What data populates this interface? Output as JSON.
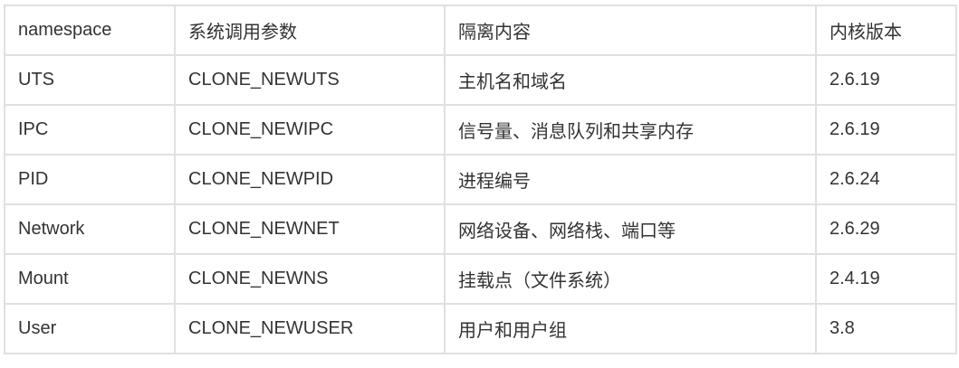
{
  "table": {
    "headers": [
      "namespace",
      "系统调用参数",
      "隔离内容",
      "内核版本"
    ],
    "rows": [
      [
        "UTS",
        "CLONE_NEWUTS",
        "主机名和域名",
        "2.6.19"
      ],
      [
        "IPC",
        "CLONE_NEWIPC",
        "信号量、消息队列和共享内存",
        "2.6.19"
      ],
      [
        "PID",
        "CLONE_NEWPID",
        "进程编号",
        "2.6.24"
      ],
      [
        "Network",
        "CLONE_NEWNET",
        "网络设备、网络栈、端口等",
        "2.6.29"
      ],
      [
        "Mount",
        "CLONE_NEWNS",
        "挂载点（文件系统）",
        "2.4.19"
      ],
      [
        "User",
        "CLONE_NEWUSER",
        "用户和用户组",
        "3.8"
      ]
    ]
  }
}
